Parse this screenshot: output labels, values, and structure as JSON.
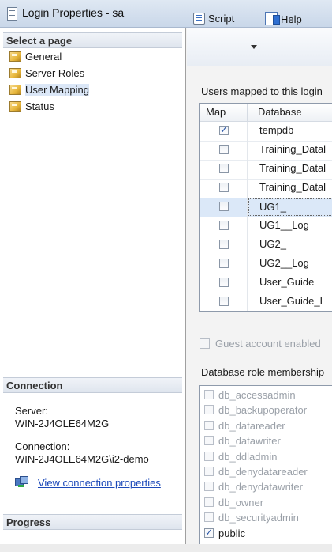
{
  "window": {
    "title": "Login Properties - sa"
  },
  "left_panel": {
    "select_header": "Select a page",
    "pages": [
      {
        "label": "General"
      },
      {
        "label": "Server Roles"
      },
      {
        "label": "User Mapping"
      },
      {
        "label": "Status"
      }
    ],
    "connection_header": "Connection",
    "server_label": "Server:",
    "server_value": "WIN-2J4OLE64M2G",
    "connection_label": "Connection:",
    "connection_value": "WIN-2J4OLE64M2G\\i2-demo",
    "view_connection_link": "View connection properties",
    "progress_header": "Progress"
  },
  "toolbar": {
    "script_label": "Script",
    "help_label": "Help"
  },
  "mapping": {
    "caption": "Users mapped to this login",
    "columns": {
      "map": "Map",
      "database": "Database"
    },
    "rows": [
      {
        "database": "tempdb",
        "mapped": true
      },
      {
        "database": "Training_Datal",
        "mapped": false
      },
      {
        "database": "Training_Datal",
        "mapped": false
      },
      {
        "database": "Training_Datal",
        "mapped": false
      },
      {
        "database": "UG1_",
        "mapped": false,
        "selected": true
      },
      {
        "database": "UG1__Log",
        "mapped": false
      },
      {
        "database": "UG2_",
        "mapped": false
      },
      {
        "database": "UG2__Log",
        "mapped": false
      },
      {
        "database": "User_Guide",
        "mapped": false
      },
      {
        "database": "User_Guide_L",
        "mapped": false
      }
    ]
  },
  "guest_label": "Guest account enabled",
  "roles": {
    "caption": "Database role membership",
    "items": [
      {
        "label": "db_accessadmin",
        "checked": false
      },
      {
        "label": "db_backupoperator",
        "checked": false
      },
      {
        "label": "db_datareader",
        "checked": false
      },
      {
        "label": "db_datawriter",
        "checked": false
      },
      {
        "label": "db_ddladmin",
        "checked": false
      },
      {
        "label": "db_denydatareader",
        "checked": false
      },
      {
        "label": "db_denydatawriter",
        "checked": false
      },
      {
        "label": "db_owner",
        "checked": false
      },
      {
        "label": "db_securityadmin",
        "checked": false
      },
      {
        "label": "public",
        "checked": true
      }
    ]
  }
}
